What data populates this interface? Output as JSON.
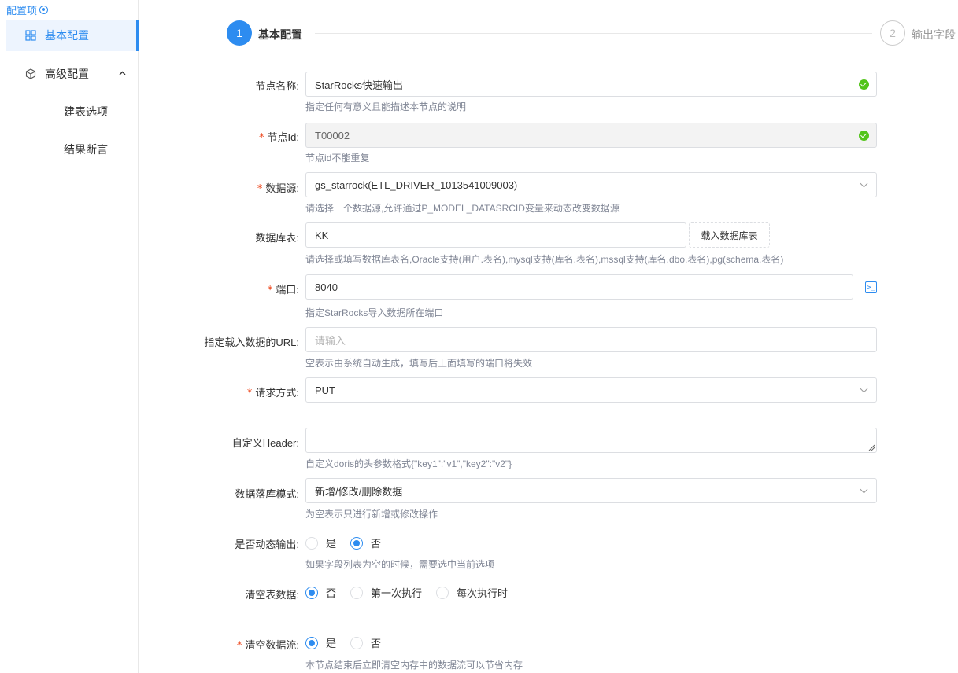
{
  "sidebar": {
    "title": "配置项",
    "items": [
      {
        "label": "基本配置",
        "icon": "grid-icon",
        "active": true
      },
      {
        "label": "高级配置",
        "icon": "cube-icon",
        "expanded": true
      }
    ],
    "subitems": [
      "建表选项",
      "结果断言"
    ]
  },
  "steps": [
    {
      "number": "1",
      "label": "基本配置"
    },
    {
      "number": "2",
      "label": "输出字段"
    }
  ],
  "form": {
    "node_name": {
      "label": "节点名称:",
      "value": "StarRocks快速输出",
      "help": "指定任何有意义且能描述本节点的说明"
    },
    "node_id": {
      "label": "节点Id:",
      "value": "T00002",
      "help": "节点id不能重复"
    },
    "datasource": {
      "label": "数据源:",
      "value": "gs_starrock(ETL_DRIVER_1013541009003)",
      "help": "请选择一个数据源,允许通过P_MODEL_DATASRCID变量来动态改变数据源"
    },
    "table": {
      "label": "数据库表:",
      "value": "KK",
      "button": "载入数据库表",
      "help": "请选择或填写数据库表名,Oracle支持(用户.表名),mysql支持(库名.表名),mssql支持(库名.dbo.表名),pg(schema.表名)"
    },
    "port": {
      "label": "端口:",
      "value": "8040",
      "help": "指定StarRocks导入数据所在端口"
    },
    "url": {
      "label": "指定载入数据的URL:",
      "placeholder": "请输入",
      "help": "空表示由系统自动生成，填写后上面填写的端口将失效"
    },
    "method": {
      "label": "请求方式:",
      "value": "PUT"
    },
    "header": {
      "label": "自定义Header:",
      "help": "自定义doris的头参数格式{\"key1\":\"v1\",\"key2\":\"v2\"}"
    },
    "mode": {
      "label": "数据落库模式:",
      "value": "新增/修改/删除数据",
      "help": "为空表示只进行新增或修改操作"
    },
    "dynamic": {
      "label": "是否动态输出:",
      "options": [
        "是",
        "否"
      ],
      "selected": 1,
      "help": "如果字段列表为空的时候，需要选中当前选项"
    },
    "clear_table": {
      "label": "清空表数据:",
      "options": [
        "否",
        "第一次执行",
        "每次执行时"
      ],
      "selected": 0
    },
    "clear_stream": {
      "label": "清空数据流:",
      "options": [
        "是",
        "否"
      ],
      "selected": 0,
      "help": "本节点结束后立即清空内存中的数据流可以节省内存"
    }
  },
  "colors": {
    "primary": "#2d8cf0",
    "required": "#ed4014",
    "success": "#52c41a"
  }
}
